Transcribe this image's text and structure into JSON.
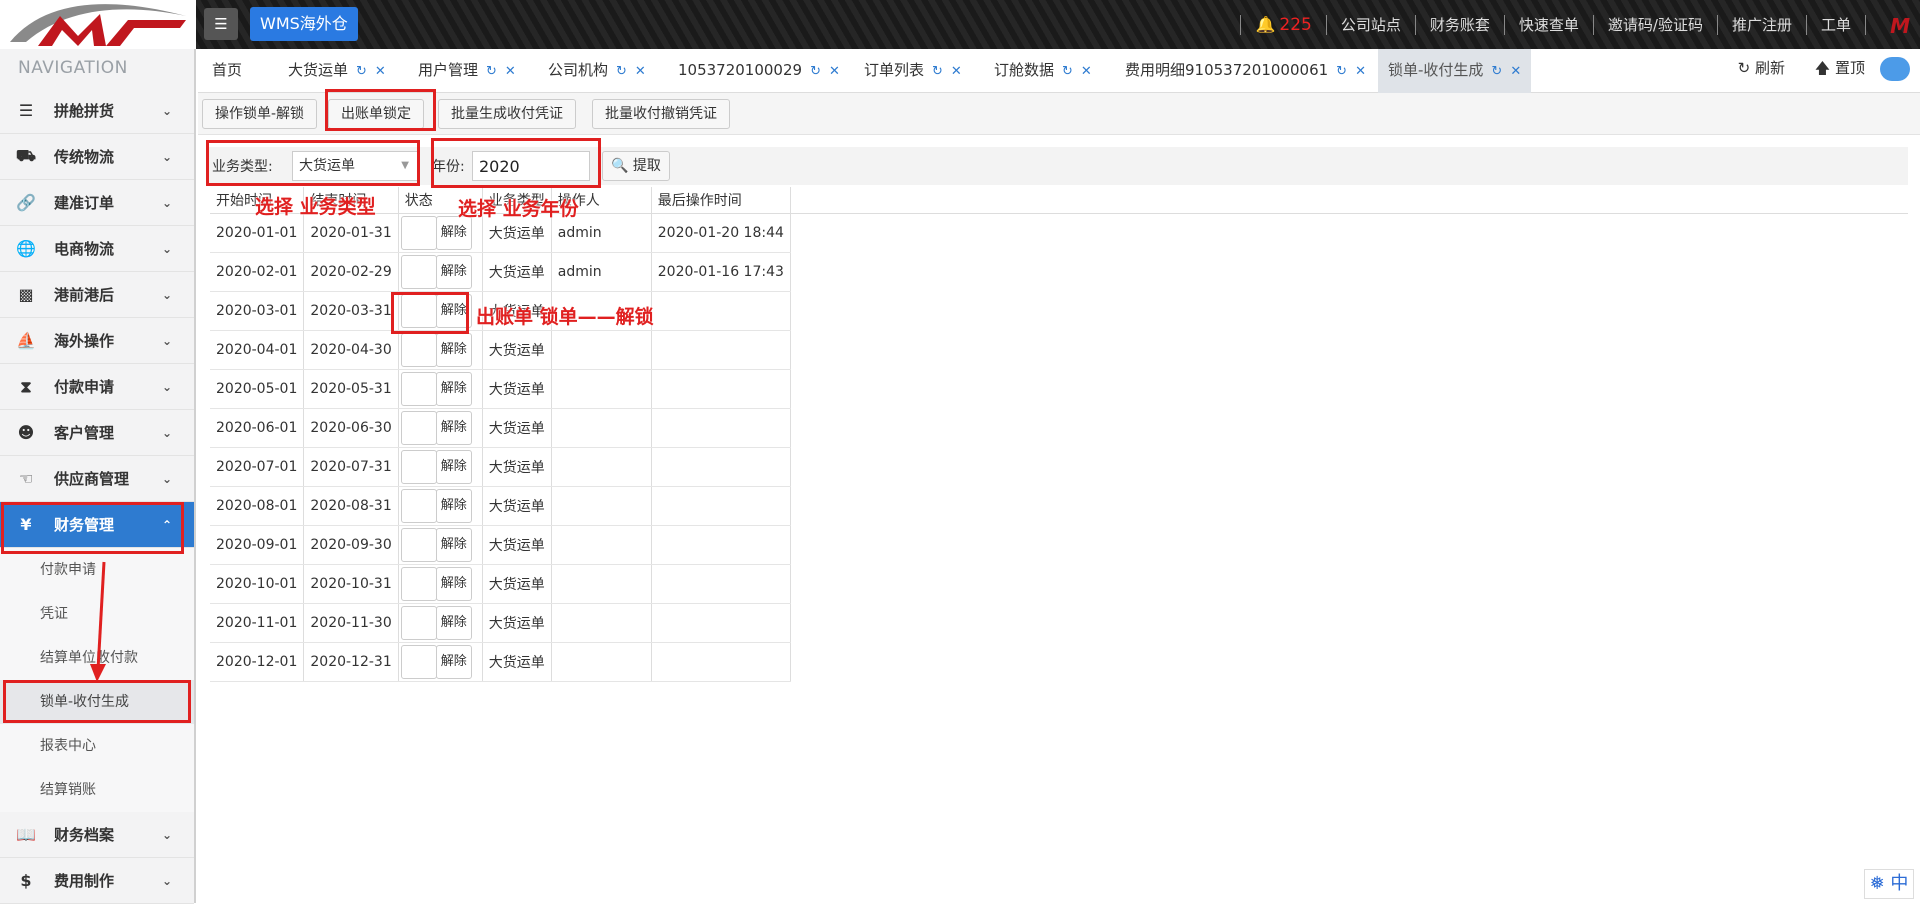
{
  "header": {
    "app_badge": "WMS海外仓",
    "notification_count": "225",
    "links": [
      "公司站点",
      "财务账套",
      "快速查单",
      "邀请码/验证码",
      "推广注册",
      "工单"
    ]
  },
  "sidebar": {
    "title": "NAVIGATION",
    "items": [
      {
        "label": "拼舱拼货",
        "icon": "list-icon"
      },
      {
        "label": "传统物流",
        "icon": "truck-icon"
      },
      {
        "label": "建准订单",
        "icon": "link-icon"
      },
      {
        "label": "电商物流",
        "icon": "globe-icon"
      },
      {
        "label": "港前港后",
        "icon": "cubes-icon"
      },
      {
        "label": "海外操作",
        "icon": "ship-icon"
      },
      {
        "label": "付款申请",
        "icon": "motorcycle-icon"
      },
      {
        "label": "客户管理",
        "icon": "users-icon"
      },
      {
        "label": "供应商管理",
        "icon": "thumbs-up-icon"
      },
      {
        "label": "财务管理",
        "icon": "yen-icon"
      }
    ],
    "sub_items": [
      "付款申请",
      "凭证",
      "结算单位收付款",
      "锁单-收付生成",
      "报表中心",
      "结算销账"
    ],
    "bottom_items": [
      {
        "label": "财务档案",
        "icon": "book-icon"
      },
      {
        "label": "费用制作",
        "icon": "dollar-icon"
      }
    ]
  },
  "tabs": [
    "首页",
    "大货运单",
    "用户管理",
    "公司机构",
    "1053720100029",
    "订单列表",
    "订舱数据",
    "费用明细910537201000061",
    "锁单-收付生成"
  ],
  "tab_actions": {
    "refresh": "刷新",
    "top": "置顶"
  },
  "sub_buttons": [
    "操作锁单-解锁",
    "出账单锁定",
    "批量生成收付凭证",
    "批量收付撤销凭证"
  ],
  "filter": {
    "business_type_label": "业务类型:",
    "business_type_value": "大货运单",
    "year_label": "年份:",
    "year_value": "2020",
    "fetch_label": "提取"
  },
  "table": {
    "headers": [
      "开始时间",
      "结束时间",
      "状态",
      "业务类型",
      "操作人",
      "最后操作时间"
    ],
    "unlock_label": "解除",
    "rows": [
      {
        "start": "2020-01-01",
        "end": "2020-01-31",
        "type": "大货运单",
        "operator": "admin",
        "time": "2020-01-20 18:44"
      },
      {
        "start": "2020-02-01",
        "end": "2020-02-29",
        "type": "大货运单",
        "operator": "admin",
        "time": "2020-01-16 17:43"
      },
      {
        "start": "2020-03-01",
        "end": "2020-03-31",
        "type": "大货运单",
        "operator": "",
        "time": ""
      },
      {
        "start": "2020-04-01",
        "end": "2020-04-30",
        "type": "大货运单",
        "operator": "",
        "time": ""
      },
      {
        "start": "2020-05-01",
        "end": "2020-05-31",
        "type": "大货运单",
        "operator": "",
        "time": ""
      },
      {
        "start": "2020-06-01",
        "end": "2020-06-30",
        "type": "大货运单",
        "operator": "",
        "time": ""
      },
      {
        "start": "2020-07-01",
        "end": "2020-07-31",
        "type": "大货运单",
        "operator": "",
        "time": ""
      },
      {
        "start": "2020-08-01",
        "end": "2020-08-31",
        "type": "大货运单",
        "operator": "",
        "time": ""
      },
      {
        "start": "2020-09-01",
        "end": "2020-09-30",
        "type": "大货运单",
        "operator": "",
        "time": ""
      },
      {
        "start": "2020-10-01",
        "end": "2020-10-31",
        "type": "大货运单",
        "operator": "",
        "time": ""
      },
      {
        "start": "2020-11-01",
        "end": "2020-11-30",
        "type": "大货运单",
        "operator": "",
        "time": ""
      },
      {
        "start": "2020-12-01",
        "end": "2020-12-31",
        "type": "大货运单",
        "operator": "",
        "time": ""
      }
    ]
  },
  "annotations": {
    "select_business_type": "选择 业务类型",
    "select_year": "选择 业务年份",
    "unlock_note": "出账单 锁单——解锁"
  },
  "ime_label": "中",
  "colors": {
    "accent": "#2e7bd0",
    "annotation_red": "#e02020",
    "badge_blue": "#2a7ae2"
  }
}
